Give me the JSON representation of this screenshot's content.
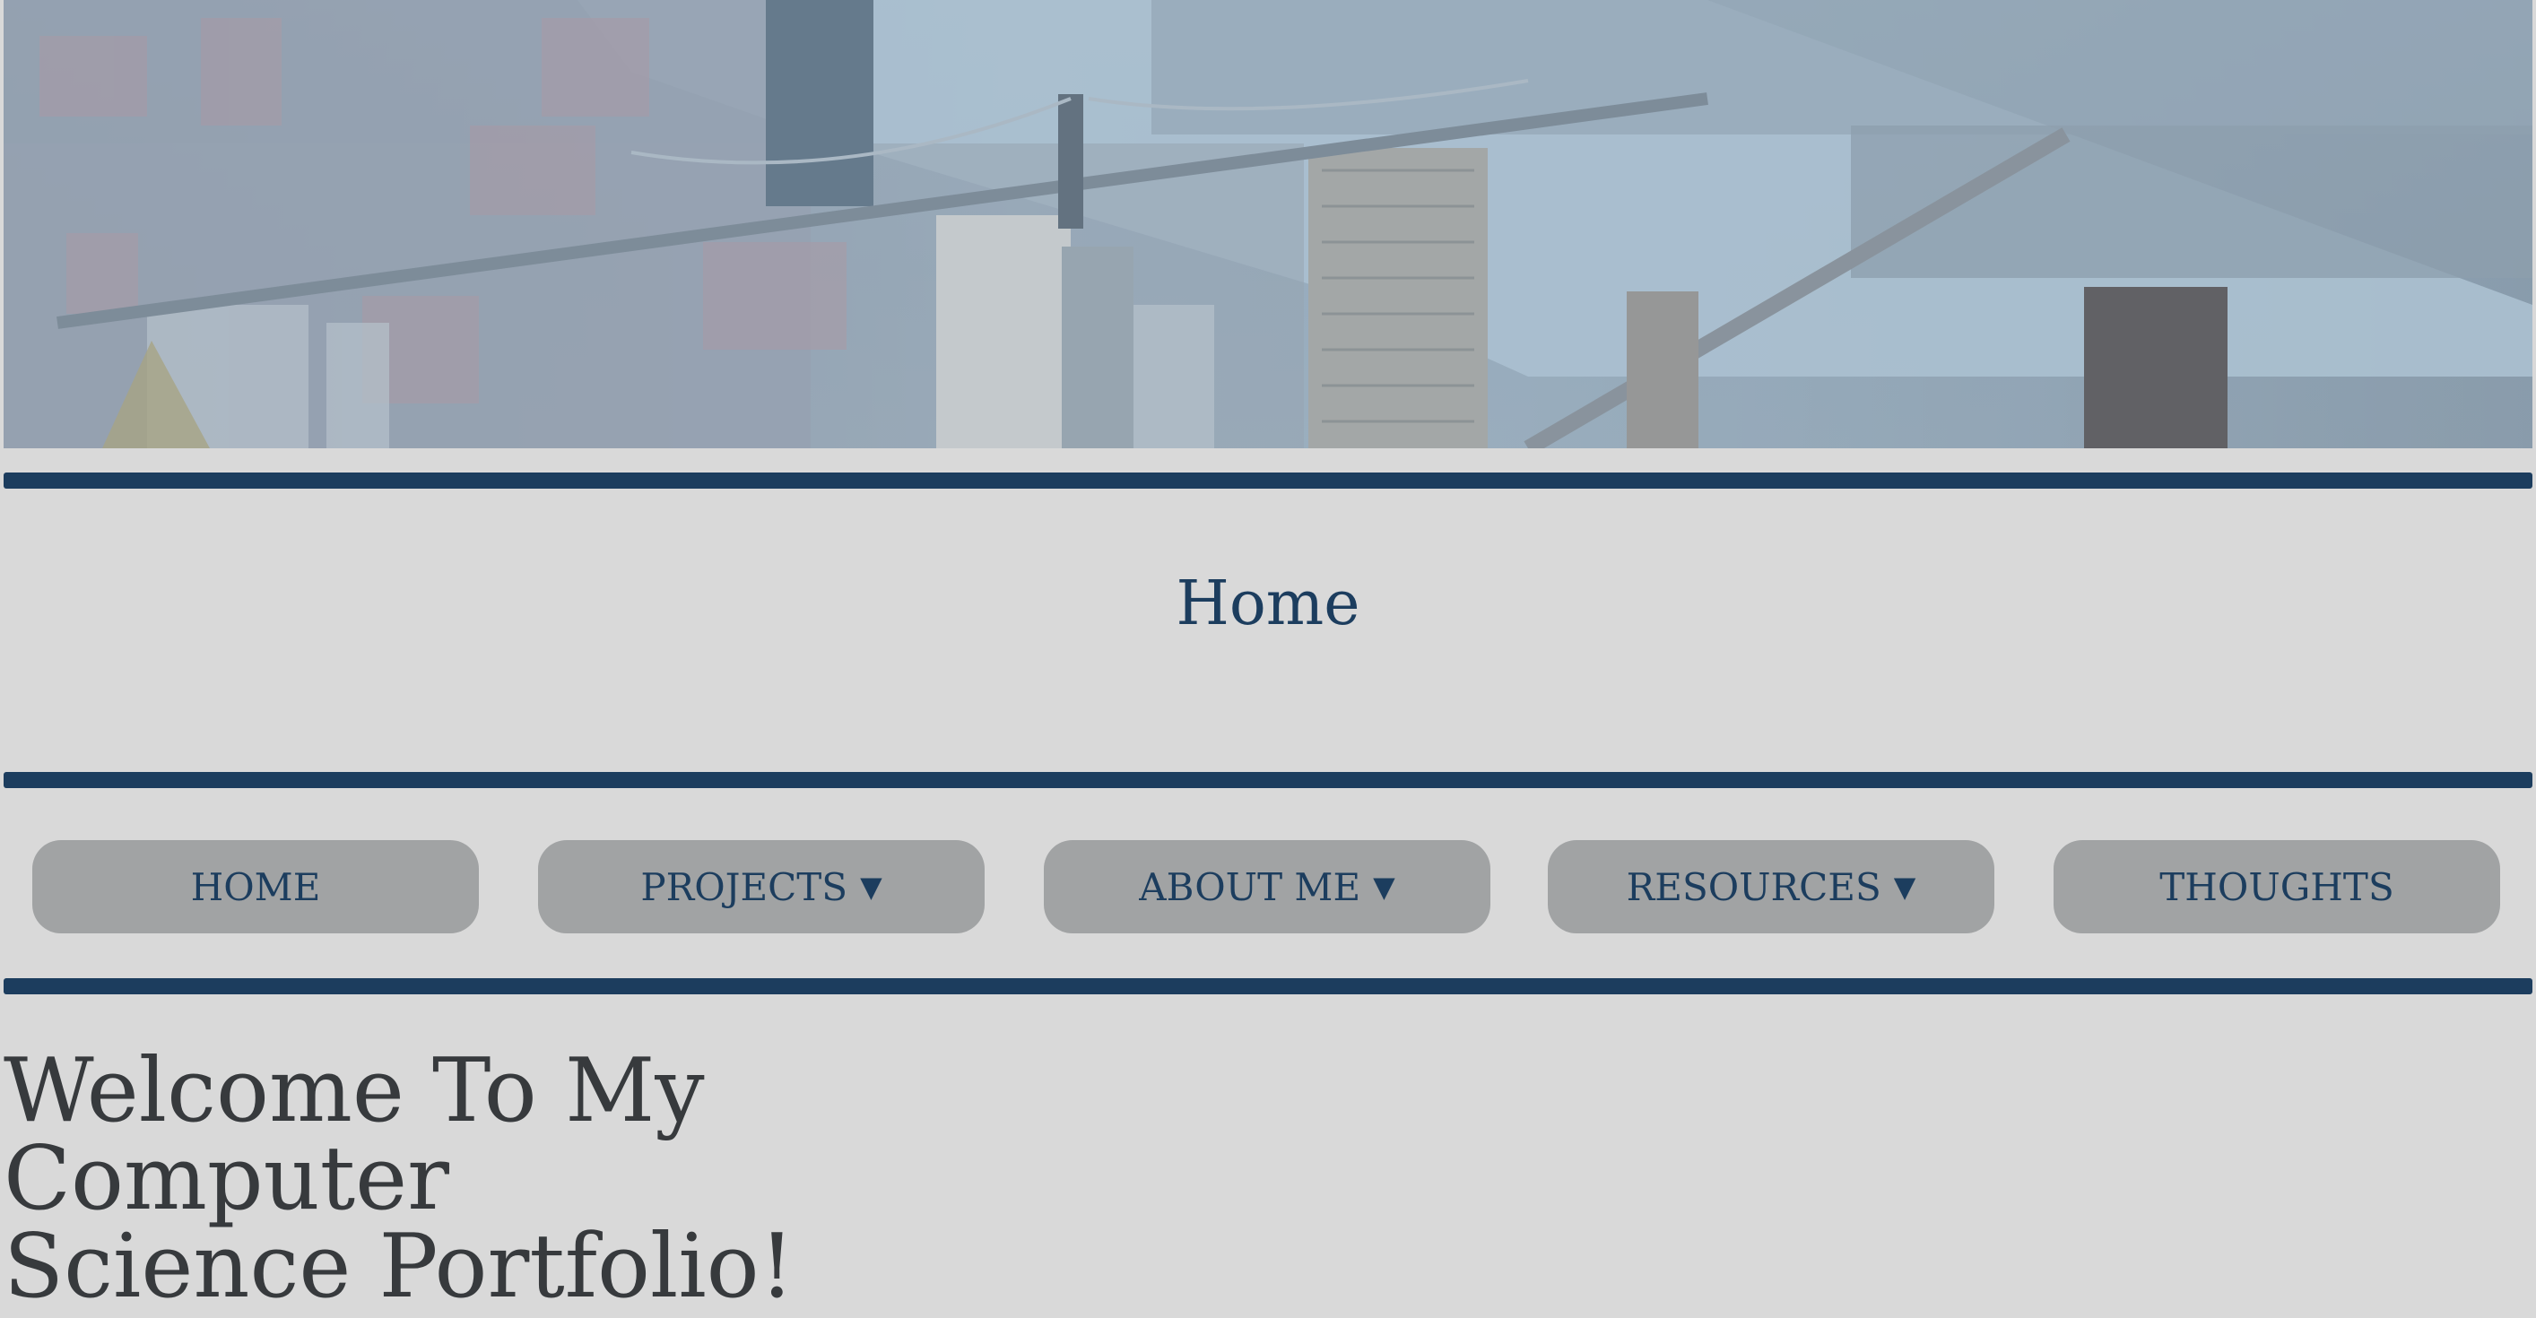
{
  "banner": {
    "image_description_icon": "city-skyline-photo-icon"
  },
  "header": {
    "title": "Home"
  },
  "nav": {
    "items": [
      {
        "label": "HOME",
        "has_dropdown": false
      },
      {
        "label": "PROJECTS",
        "has_dropdown": true
      },
      {
        "label": "ABOUT ME",
        "has_dropdown": true
      },
      {
        "label": "RESOURCES",
        "has_dropdown": true
      },
      {
        "label": "THOUGHTS",
        "has_dropdown": false
      }
    ],
    "caret": "▼"
  },
  "main": {
    "heading_line1": "Welcome To My Computer",
    "heading_line2": "Science Portfolio!"
  },
  "colors": {
    "background": "#d9d9d9",
    "accent_navy": "#1c3d5e",
    "button_gray": "#a1a3a4",
    "heading_text": "#373a3d"
  }
}
